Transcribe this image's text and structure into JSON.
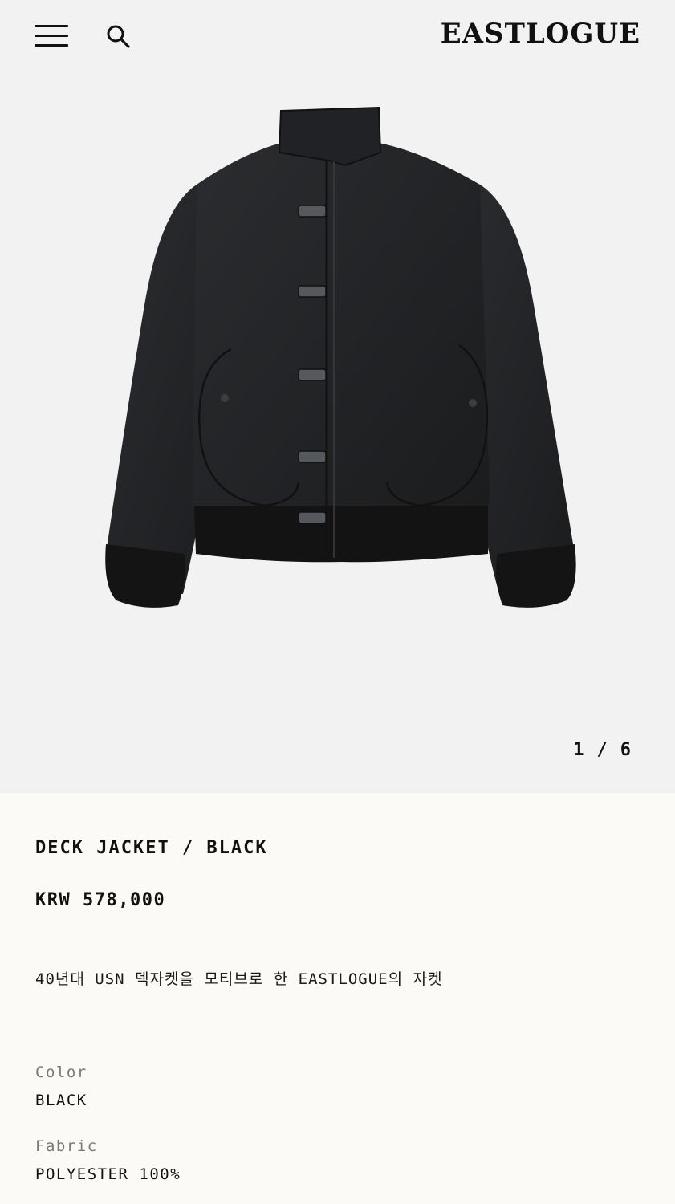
{
  "header": {
    "menu_icon": "hamburger-menu-icon",
    "search_icon": "search-icon",
    "logo": "EASTLOGUE"
  },
  "gallery": {
    "image_subject": "jacket",
    "current": "1",
    "separator": "/",
    "total": "6"
  },
  "product": {
    "title": "DECK JACKET / BLACK",
    "price": "KRW 578,000",
    "description": "40년대 USN 덱자켓을 모티브로 한 EASTLOGUE의 자켓",
    "specs": [
      {
        "label": "Color",
        "value": "BLACK"
      },
      {
        "label": "Fabric",
        "value": "POLYESTER 100%"
      }
    ]
  },
  "colors": {
    "background": "#f2f2f3",
    "info_background": "#fbfaf6",
    "text": "#111111",
    "muted": "#7a7a7a",
    "jacket": "#222426"
  }
}
